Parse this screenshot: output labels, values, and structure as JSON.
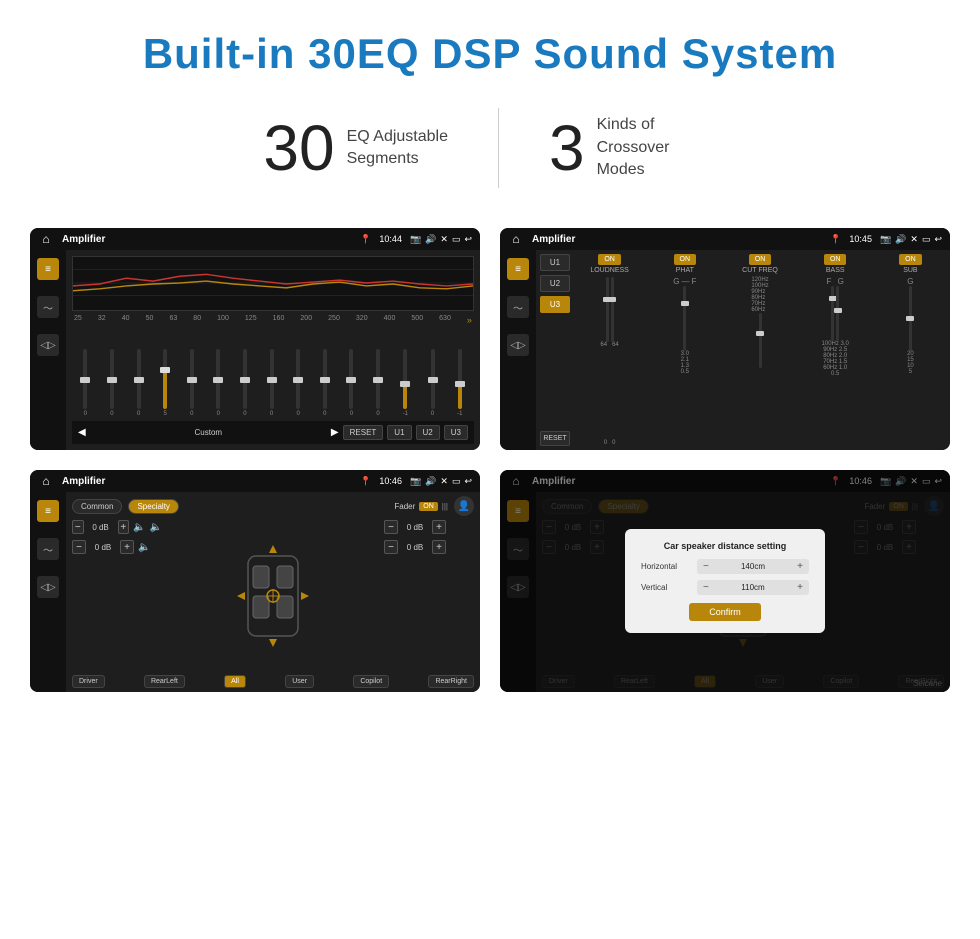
{
  "header": {
    "title": "Built-in 30EQ DSP Sound System"
  },
  "stats": [
    {
      "number": "30",
      "label": "EQ Adjustable\nSegments"
    },
    {
      "number": "3",
      "label": "Kinds of\nCrossover Modes"
    }
  ],
  "screens": [
    {
      "id": "eq-screen",
      "statusBar": {
        "title": "Amplifier",
        "time": "10:44"
      },
      "type": "equalizer",
      "eqBands": [
        "25",
        "32",
        "40",
        "50",
        "63",
        "80",
        "100",
        "125",
        "160",
        "200",
        "250",
        "320",
        "400",
        "500",
        "630"
      ],
      "eqValues": [
        "0",
        "0",
        "0",
        "5",
        "0",
        "0",
        "0",
        "0",
        "0",
        "0",
        "0",
        "0",
        "-1",
        "0",
        "-1"
      ],
      "bottomBar": {
        "preset": "Custom",
        "buttons": [
          "RESET",
          "U1",
          "U2",
          "U3"
        ]
      }
    },
    {
      "id": "crossover-screen",
      "statusBar": {
        "title": "Amplifier",
        "time": "10:45"
      },
      "type": "crossover",
      "presets": [
        "U1",
        "U2",
        "U3"
      ],
      "activePreset": "U3",
      "channels": [
        {
          "name": "LOUDNESS",
          "on": true
        },
        {
          "name": "PHAT",
          "on": true
        },
        {
          "name": "CUT FREQ",
          "on": true
        },
        {
          "name": "BASS",
          "on": true
        },
        {
          "name": "SUB",
          "on": true
        }
      ],
      "resetLabel": "RESET"
    },
    {
      "id": "fader-screen",
      "statusBar": {
        "title": "Amplifier",
        "time": "10:46"
      },
      "type": "fader",
      "modes": [
        "Common",
        "Specialty"
      ],
      "activeMode": "Specialty",
      "faderLabel": "Fader",
      "faderOn": true,
      "channels": [
        {
          "position": "top-left",
          "db": "0 dB"
        },
        {
          "position": "top-right",
          "db": "0 dB"
        },
        {
          "position": "bottom-left",
          "db": "0 dB"
        },
        {
          "position": "bottom-right",
          "db": "0 dB"
        }
      ],
      "bottomButtons": [
        "Driver",
        "RearLeft",
        "All",
        "User",
        "Copilot",
        "RearRight"
      ]
    },
    {
      "id": "distance-screen",
      "statusBar": {
        "title": "Amplifier",
        "time": "10:46"
      },
      "type": "distance-dialog",
      "modes": [
        "Common",
        "Specialty"
      ],
      "activeMode": "Specialty",
      "dialog": {
        "title": "Car speaker distance setting",
        "horizontal": {
          "label": "Horizontal",
          "value": "140cm"
        },
        "vertical": {
          "label": "Vertical",
          "value": "110cm"
        },
        "confirmLabel": "Confirm"
      },
      "bottomButtons": [
        "Driver",
        "RearLeft",
        "All",
        "User",
        "Copilot",
        "RearRight"
      ]
    }
  ]
}
